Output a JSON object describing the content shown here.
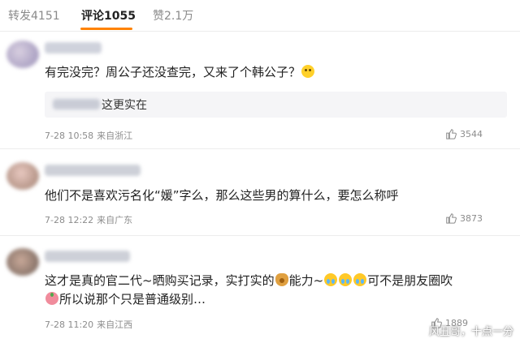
{
  "tabs": [
    {
      "label": "转发4151"
    },
    {
      "label": "评论1055"
    },
    {
      "label": "赞2.1万"
    }
  ],
  "comments": [
    {
      "text": "有完没完？周公子还没查完，又来了个韩公子？",
      "reply": {
        "text": "这更实在"
      },
      "date": "7-28 10:58",
      "location": "来自浙江",
      "likes": "3544"
    },
    {
      "text": "他们不是喜欢污名化“媛”字么，那么这些男的算什么，要怎么称呼",
      "date": "7-28 12:22",
      "location": "来自广东",
      "likes": "3873"
    },
    {
      "text_line1_a": "这才是真的官二代~晒购买记录，实打实的",
      "text_line1_b": "能力~",
      "text_line1_c": "可不是朋友圈吹",
      "text_line2": "所以说那个只是普通级别…",
      "date": "7-28 11:20",
      "location": "来自江西",
      "likes": "1889"
    }
  ],
  "watermark": "风丑哥，十点一分",
  "icons": {
    "like": "thumbs-up-icon",
    "emoji_cry": "crying-face-icon",
    "emoji_bag": "money-bag-icon",
    "emoji_tear": "tearful-face-icon",
    "emoji_peach": "peach-icon"
  },
  "colors": {
    "active_tab_underline": "#ff8200",
    "reply_background": "#f5f5f7",
    "meta_text": "#8c8c8c"
  }
}
